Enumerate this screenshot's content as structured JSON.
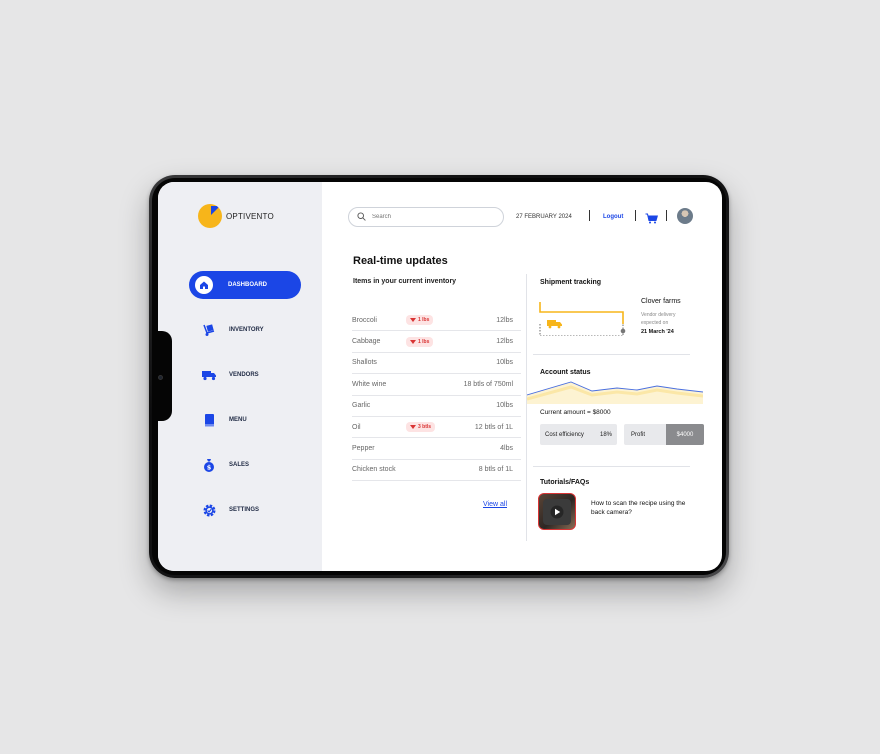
{
  "app": {
    "name": "OPTIVENTO"
  },
  "colors": {
    "accent": "#1b46e6",
    "logo": "#f7b51a",
    "alert": "#d93434",
    "chart_line": "#4a6fe0",
    "chart_fill": "#fbe7a7"
  },
  "sidebar": {
    "items": [
      {
        "label": "DASHBOARD",
        "icon": "home-icon",
        "active": true
      },
      {
        "label": "INVENTORY",
        "icon": "dolly-icon",
        "active": false
      },
      {
        "label": "VENDORS",
        "icon": "truck-icon",
        "active": false
      },
      {
        "label": "MENU",
        "icon": "book-icon",
        "active": false
      },
      {
        "label": "SALES",
        "icon": "money-bag-icon",
        "active": false
      },
      {
        "label": "SETTINGS",
        "icon": "gear-icon",
        "active": false
      }
    ]
  },
  "topbar": {
    "search_placeholder": "Search",
    "date": "27 FEBRUARY 2024",
    "logout": "Logout"
  },
  "main": {
    "title": "Real-time updates",
    "inventory": {
      "subtitle": "Items in your current inventory",
      "rows": [
        {
          "name": "Broccoli",
          "badge": "1 lbs",
          "qty": "12lbs"
        },
        {
          "name": "Cabbage",
          "badge": "1 lbs",
          "qty": "12lbs"
        },
        {
          "name": "Shallots",
          "badge": "",
          "qty": "10lbs"
        },
        {
          "name": "White wine",
          "badge": "",
          "qty": "18 btls of 750ml"
        },
        {
          "name": "Garlic",
          "badge": "",
          "qty": "10lbs"
        },
        {
          "name": "Oil",
          "badge": "3 btls",
          "qty": "12 btls of 1L"
        },
        {
          "name": "Pepper",
          "badge": "",
          "qty": "4lbs"
        },
        {
          "name": "Chicken stock",
          "badge": "",
          "qty": "8 btls of 1L"
        }
      ],
      "view_all": "View all"
    },
    "shipment": {
      "title": "Shipment tracking",
      "vendor": "Clover farms",
      "note": "Vendor delivery expected on",
      "date": "21 March '24"
    },
    "account": {
      "title": "Account status",
      "current": "Current amount = $8000",
      "efficiency_label": "Cost efficiency",
      "efficiency_value": "18%",
      "profit_label": "Profit",
      "profit_value": "$4000"
    },
    "tutorials": {
      "title": "Tutorials/FAQs",
      "item": "How to scan the recipe using the back camera?"
    }
  }
}
